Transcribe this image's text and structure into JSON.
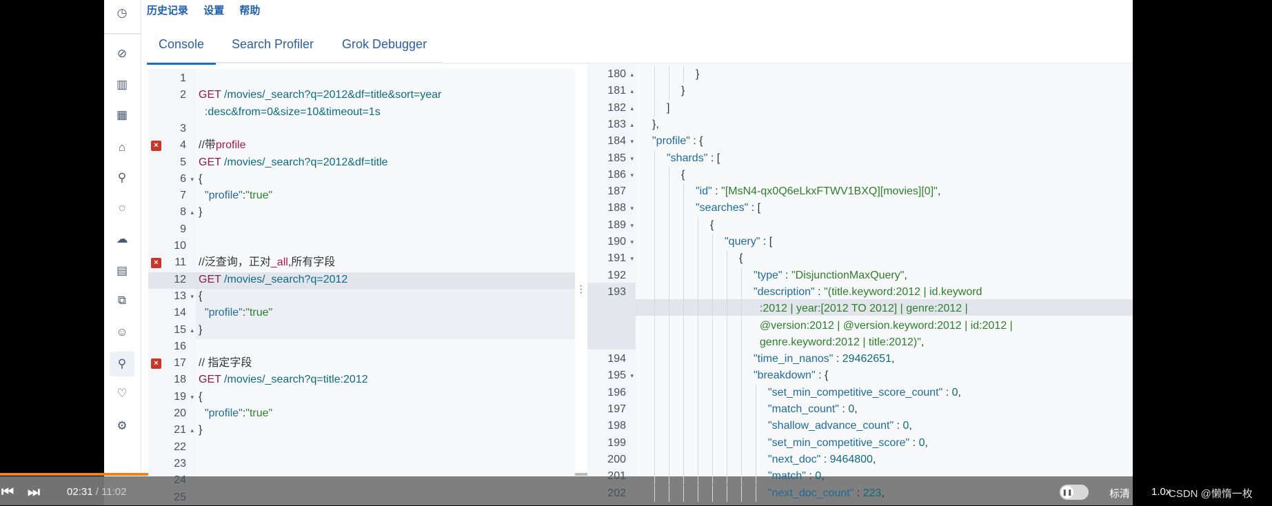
{
  "menu": {
    "items": [
      "历史记录",
      "设置",
      "帮助"
    ]
  },
  "tabs": [
    {
      "label": "Console",
      "active": true
    },
    {
      "label": "Search Profiler"
    },
    {
      "label": "Grok Debugger"
    }
  ],
  "sidebar": {
    "icons": [
      "clock-icon",
      "compass-icon",
      "visualize-icon",
      "dashboard-icon",
      "canvas-icon",
      "maps-icon",
      "ml-icon",
      "infrastructure-icon",
      "logs-icon",
      "apm-icon",
      "uptime-icon",
      "dev-tools-icon",
      "monitoring-icon",
      "management-icon"
    ]
  },
  "colors": {
    "accent": "#1f6fc0",
    "error": "#c8382a",
    "highlight_box": "#f0231e",
    "progress": "#f0821e"
  },
  "left_editor": {
    "error_lines": [
      4,
      11,
      17
    ],
    "lines": [
      {
        "n": "1",
        "segs": []
      },
      {
        "n": "2",
        "segs": [
          [
            "GET",
            "k"
          ],
          [
            " /movies/_search?q=2012&df=title&sort=year",
            "p"
          ]
        ]
      },
      {
        "n": "",
        "segs": [
          [
            "  :desc&from=0&size=10&timeout=1s",
            "p"
          ]
        ]
      },
      {
        "n": "3",
        "segs": []
      },
      {
        "n": "4",
        "segs": [
          [
            "//带",
            "cm"
          ],
          [
            "profile",
            "cmk"
          ]
        ]
      },
      {
        "n": "5",
        "segs": [
          [
            "GET",
            "k"
          ],
          [
            " /movies/_search?q=2012&df=title",
            "p"
          ]
        ]
      },
      {
        "n": "6",
        "fold": "▾",
        "segs": [
          [
            "{",
            "pun"
          ]
        ]
      },
      {
        "n": "7",
        "segs": [
          [
            "  ",
            "pun"
          ],
          [
            "\"profile\"",
            "key"
          ],
          [
            ":",
            "pun"
          ],
          [
            "\"true\"",
            "str"
          ]
        ]
      },
      {
        "n": "8",
        "fold": "▴",
        "segs": [
          [
            "}",
            "pun"
          ]
        ]
      },
      {
        "n": "9",
        "segs": []
      },
      {
        "n": "10",
        "segs": []
      },
      {
        "n": "11",
        "segs": [
          [
            "//泛查询，正对",
            "cm"
          ],
          [
            "_all",
            "cmk"
          ],
          [
            ",所有字段",
            "cm"
          ]
        ]
      },
      {
        "n": "12",
        "segs": [
          [
            "GET",
            "k"
          ],
          [
            " /movies/_search?q=2012",
            "p"
          ]
        ]
      },
      {
        "n": "13",
        "fold": "▾",
        "segs": [
          [
            "{",
            "pun"
          ]
        ]
      },
      {
        "n": "14",
        "segs": [
          [
            "  ",
            "pun"
          ],
          [
            "\"profile\"",
            "key"
          ],
          [
            ":",
            "pun"
          ],
          [
            "\"true\"",
            "str"
          ]
        ]
      },
      {
        "n": "15",
        "fold": "▴",
        "segs": [
          [
            "}",
            "pun"
          ]
        ]
      },
      {
        "n": "16",
        "segs": []
      },
      {
        "n": "17",
        "segs": [
          [
            "// 指定字段",
            "cm"
          ]
        ]
      },
      {
        "n": "18",
        "segs": [
          [
            "GET",
            "k"
          ],
          [
            " /movies/_search?q=title:2012",
            "p"
          ]
        ]
      },
      {
        "n": "19",
        "fold": "▾",
        "segs": [
          [
            "{",
            "pun"
          ]
        ]
      },
      {
        "n": "20",
        "segs": [
          [
            "  ",
            "pun"
          ],
          [
            "\"profile\"",
            "key"
          ],
          [
            ":",
            "pun"
          ],
          [
            "\"true\"",
            "str"
          ]
        ]
      },
      {
        "n": "21",
        "fold": "▴",
        "segs": [
          [
            "}",
            "pun"
          ]
        ]
      },
      {
        "n": "22",
        "segs": []
      },
      {
        "n": "23",
        "segs": []
      },
      {
        "n": "24",
        "segs": []
      },
      {
        "n": "25",
        "segs": []
      }
    ]
  },
  "right_editor": {
    "lines": [
      {
        "n": "180",
        "fold": "▴",
        "i": 3,
        "segs": [
          [
            "}",
            "pun"
          ]
        ]
      },
      {
        "n": "181",
        "fold": "▴",
        "i": 2,
        "segs": [
          [
            "}",
            "pun"
          ]
        ]
      },
      {
        "n": "182",
        "fold": "▴",
        "i": 1,
        "segs": [
          [
            "]",
            "pun"
          ]
        ]
      },
      {
        "n": "183",
        "fold": "▴",
        "i": 0,
        "segs": [
          [
            "},",
            "pun"
          ]
        ]
      },
      {
        "n": "184",
        "fold": "▾",
        "i": 0,
        "segs": [
          [
            "\"profile\"",
            "key"
          ],
          [
            " : {",
            "pun"
          ]
        ]
      },
      {
        "n": "185",
        "fold": "▾",
        "i": 1,
        "segs": [
          [
            "\"shards\"",
            "key"
          ],
          [
            " : [",
            "pun"
          ]
        ]
      },
      {
        "n": "186",
        "fold": "▾",
        "i": 2,
        "segs": [
          [
            "{",
            "pun"
          ]
        ]
      },
      {
        "n": "187",
        "i": 3,
        "segs": [
          [
            "\"id\"",
            "key"
          ],
          [
            " : ",
            "pun"
          ],
          [
            "\"[MsN4-qx0Q6eLkxFTWV1BXQ][movies][0]\"",
            "str"
          ],
          [
            ",",
            "pun"
          ]
        ]
      },
      {
        "n": "188",
        "fold": "▾",
        "i": 3,
        "segs": [
          [
            "\"searches\"",
            "key"
          ],
          [
            " : [",
            "pun"
          ]
        ]
      },
      {
        "n": "189",
        "fold": "▾",
        "i": 4,
        "segs": [
          [
            "{",
            "pun"
          ]
        ]
      },
      {
        "n": "190",
        "fold": "▾",
        "i": 5,
        "segs": [
          [
            "\"query\"",
            "key"
          ],
          [
            " : [",
            "pun"
          ]
        ]
      },
      {
        "n": "191",
        "fold": "▾",
        "i": 6,
        "segs": [
          [
            "{",
            "pun"
          ]
        ]
      },
      {
        "n": "192",
        "i": 7,
        "segs": [
          [
            "\"type\"",
            "key"
          ],
          [
            " : ",
            "pun"
          ],
          [
            "\"DisjunctionMaxQuery\"",
            "str"
          ],
          [
            ",",
            "pun"
          ]
        ]
      },
      {
        "n": "193",
        "i": 7,
        "segs": [
          [
            "\"description\"",
            "key"
          ],
          [
            " : ",
            "pun"
          ],
          [
            "\"(title.keyword:2012 | id.keyword",
            "str"
          ]
        ]
      },
      {
        "n": "",
        "i": 7,
        "segs": [
          [
            "  :2012 | year:[2012 TO 2012] | genre:2012 |",
            "str"
          ]
        ]
      },
      {
        "n": "",
        "i": 7,
        "segs": [
          [
            "  @version:2012 | @version.keyword:2012 | id:2012 |",
            "str"
          ]
        ]
      },
      {
        "n": "",
        "i": 7,
        "segs": [
          [
            "  genre.keyword:2012 | title:2012)\"",
            "str"
          ],
          [
            ",",
            "pun"
          ]
        ]
      },
      {
        "n": "194",
        "i": 7,
        "segs": [
          [
            "\"time_in_nanos\"",
            "key"
          ],
          [
            " : ",
            "pun"
          ],
          [
            "29462651",
            "num"
          ],
          [
            ",",
            "pun"
          ]
        ]
      },
      {
        "n": "195",
        "fold": "▾",
        "i": 7,
        "segs": [
          [
            "\"breakdown\"",
            "key"
          ],
          [
            " : {",
            "pun"
          ]
        ]
      },
      {
        "n": "196",
        "i": 8,
        "segs": [
          [
            "\"set_min_competitive_score_count\"",
            "key"
          ],
          [
            " : ",
            "pun"
          ],
          [
            "0",
            "num"
          ],
          [
            ",",
            "pun"
          ]
        ]
      },
      {
        "n": "197",
        "i": 8,
        "segs": [
          [
            "\"match_count\"",
            "key"
          ],
          [
            " : ",
            "pun"
          ],
          [
            "0",
            "num"
          ],
          [
            ",",
            "pun"
          ]
        ]
      },
      {
        "n": "198",
        "i": 8,
        "segs": [
          [
            "\"shallow_advance_count\"",
            "key"
          ],
          [
            " : ",
            "pun"
          ],
          [
            "0",
            "num"
          ],
          [
            ",",
            "pun"
          ]
        ]
      },
      {
        "n": "199",
        "i": 8,
        "segs": [
          [
            "\"set_min_competitive_score\"",
            "key"
          ],
          [
            " : ",
            "pun"
          ],
          [
            "0",
            "num"
          ],
          [
            ",",
            "pun"
          ]
        ]
      },
      {
        "n": "200",
        "i": 8,
        "segs": [
          [
            "\"next_doc\"",
            "key"
          ],
          [
            " : ",
            "pun"
          ],
          [
            "9464800",
            "num"
          ],
          [
            ",",
            "pun"
          ]
        ]
      },
      {
        "n": "201",
        "i": 8,
        "segs": [
          [
            "\"match\"",
            "key"
          ],
          [
            " : ",
            "pun"
          ],
          [
            "0",
            "num"
          ],
          [
            ",",
            "pun"
          ]
        ]
      },
      {
        "n": "202",
        "i": 8,
        "segs": [
          [
            "\"next_doc_count\"",
            "key"
          ],
          [
            " : ",
            "pun"
          ],
          [
            "223",
            "num"
          ],
          [
            ",",
            "pun"
          ]
        ]
      }
    ]
  },
  "player": {
    "current_time": "02:31",
    "separator": "/",
    "duration": "11:02",
    "progress_percent": 22.9,
    "quality": "标清",
    "speed": "1.0x",
    "watermark": "CSDN @懒惰一枚"
  }
}
